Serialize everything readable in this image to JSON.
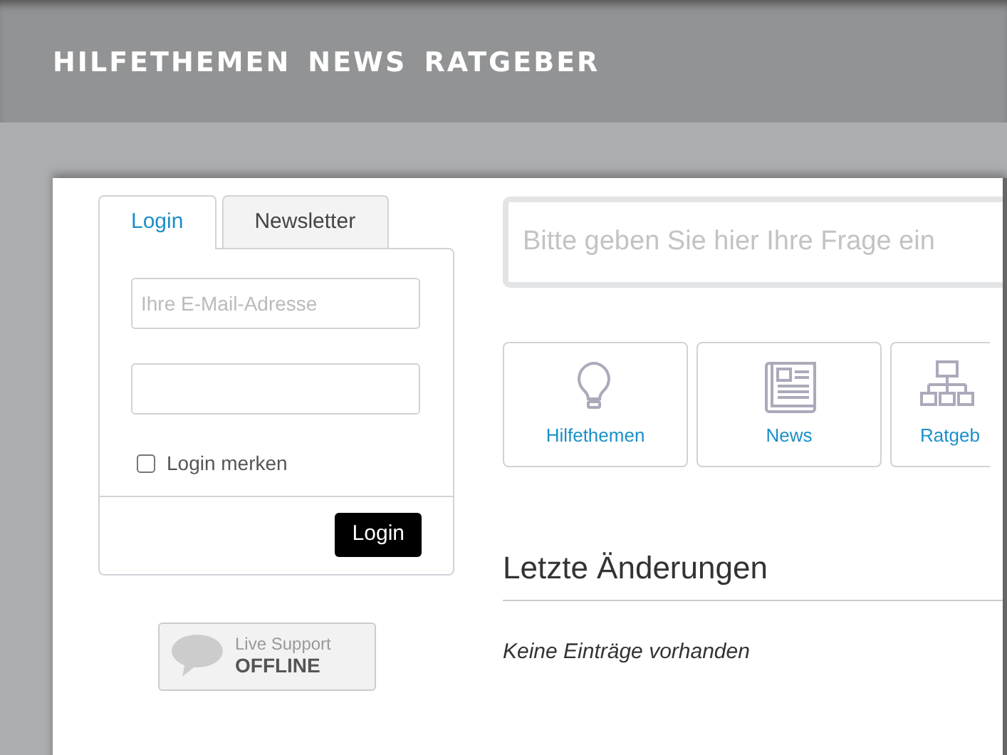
{
  "nav": [
    "HILFETHEMEN",
    "NEWS",
    "RATGEBER"
  ],
  "login_box": {
    "tabs": [
      {
        "label": "Login",
        "selected": true
      },
      {
        "label": "Newsletter",
        "selected": false
      }
    ],
    "email": {
      "placeholder": "Ihre E-Mail-Adresse"
    },
    "remember": {
      "label": "Login merken",
      "checked": false
    },
    "button": "Login"
  },
  "live_support": {
    "line_1": "Live Support",
    "line_2": "OFFLINE"
  },
  "search": {
    "placeholder": "Bitte geben Sie hier Ihre Frage ein"
  },
  "tiles": [
    {
      "kind": "bulb",
      "label": "Hilfethemen"
    },
    {
      "kind": "newspaper",
      "label": "News"
    },
    {
      "kind": "sitemap",
      "label": "Ratgeb"
    }
  ],
  "recent": {
    "heading": "Letzte Änderungen",
    "empty": "Keine Einträge vorhanden"
  }
}
